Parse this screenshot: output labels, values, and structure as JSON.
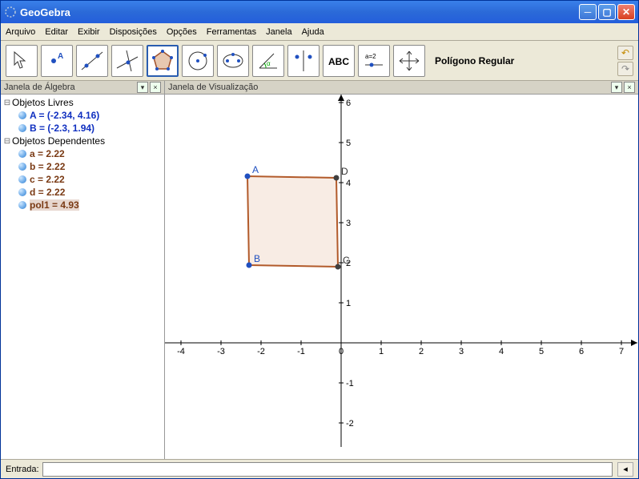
{
  "window": {
    "title": "GeoGebra"
  },
  "menu": {
    "items": [
      "Arquivo",
      "Editar",
      "Exibir",
      "Disposições",
      "Opções",
      "Ferramentas",
      "Janela",
      "Ajuda"
    ]
  },
  "toolbar": {
    "selected_label": "Polígono Regular",
    "selected_index": 4
  },
  "panes": {
    "algebra_title": "Janela de Álgebra",
    "graphics_title": "Janela de Visualização"
  },
  "algebra": {
    "free_label": "Objetos Livres",
    "dependent_label": "Objetos Dependentes",
    "free": [
      {
        "text": "A = (-2.34, 4.16)"
      },
      {
        "text": "B = (-2.3, 1.94)"
      }
    ],
    "dependent": [
      {
        "text": "a = 2.22"
      },
      {
        "text": "b = 2.22"
      },
      {
        "text": "c = 2.22"
      },
      {
        "text": "d = 2.22"
      },
      {
        "text": "pol1 = 4.93",
        "selected": true
      }
    ]
  },
  "chart_data": {
    "type": "scatter",
    "title": "",
    "xlabel": "",
    "ylabel": "",
    "xlim": [
      -4,
      7
    ],
    "ylim": [
      -2,
      6
    ],
    "xticks": [
      -4,
      -3,
      -2,
      -1,
      0,
      1,
      2,
      3,
      4,
      5,
      6,
      7
    ],
    "yticks": [
      -2,
      -1,
      1,
      2,
      3,
      4,
      5,
      6
    ],
    "points": [
      {
        "name": "A",
        "x": -2.34,
        "y": 4.16
      },
      {
        "name": "B",
        "x": -2.3,
        "y": 1.94
      },
      {
        "name": "C",
        "x": -0.08,
        "y": 1.9
      },
      {
        "name": "D",
        "x": -0.12,
        "y": 4.12
      }
    ],
    "polygon": {
      "name": "pol1",
      "vertices": [
        "A",
        "B",
        "C",
        "D"
      ],
      "fill": "#f3dccd",
      "stroke": "#b25a2a"
    },
    "segments": [
      {
        "name": "a",
        "value": 2.22
      },
      {
        "name": "b",
        "value": 2.22
      },
      {
        "name": "c",
        "value": 2.22
      },
      {
        "name": "d",
        "value": 2.22
      }
    ]
  },
  "input": {
    "label": "Entrada:",
    "value": ""
  }
}
